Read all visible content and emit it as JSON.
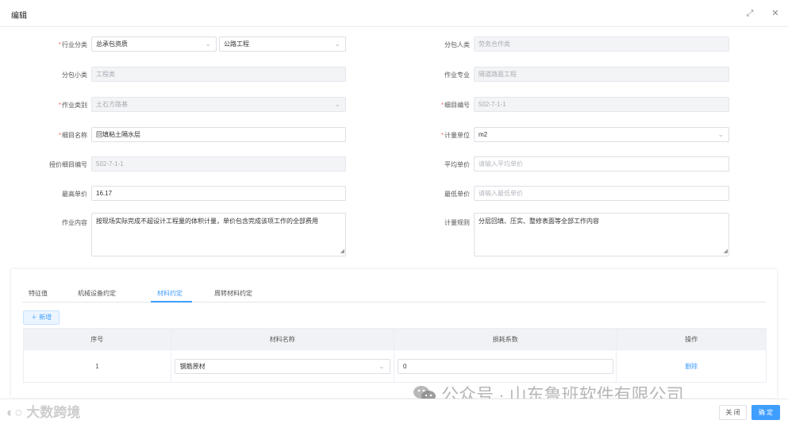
{
  "dialog": {
    "title": "编辑"
  },
  "form": {
    "industry_label": "行业分类",
    "industry_value1": "总承包资质",
    "industry_value2": "公路工程",
    "sub_category_label": "分包人类",
    "sub_category_value": "劳务合作类",
    "sub_small_label": "分包小类",
    "sub_small_value": "工程类",
    "work_major_label": "作业专业",
    "work_major_value": "隧道路面工程",
    "work_category_label": "作业类别",
    "work_category_value": "土石方路基",
    "item_code_label": "细目编号",
    "item_code_value": "502-7-1-1",
    "item_name_label": "细目名称",
    "item_name_value": "回填粘土隔水层",
    "unit_label": "计量单位",
    "unit_value": "m2",
    "quota_code_label": "授价细目编号",
    "quota_code_value": "502-7-1-1",
    "avg_price_label": "平均单价",
    "avg_price_placeholder": "请输入平均单价",
    "max_price_label": "最高单价",
    "max_price_value": "16.17",
    "min_price_label": "最低单价",
    "min_price_placeholder": "请输入最低单价",
    "work_content_label": "作业内容",
    "work_content_value": "按现场实际完成不超设计工程量的体积计量，单价包含完成该项工作的全部费用",
    "measure_rule_label": "计量规则",
    "measure_rule_value": "分层回填、压实、整修表面等全部工作内容"
  },
  "tabs": [
    "特征值",
    "机械设备约定",
    "材料约定",
    "周转材料约定"
  ],
  "active_tab": 2,
  "add_button": "新增",
  "table": {
    "headers": [
      "序号",
      "材料名称",
      "损耗系数",
      "操作"
    ],
    "rows": [
      {
        "index": "1",
        "material": "钢筋原材",
        "coefficient": "0",
        "action": "删除"
      }
    ]
  },
  "footer": {
    "close": "关 闭",
    "ok": "确 定"
  },
  "watermarks": {
    "left": "大数跨境",
    "right": "公众号 · 山东鲁班软件有限公司"
  }
}
